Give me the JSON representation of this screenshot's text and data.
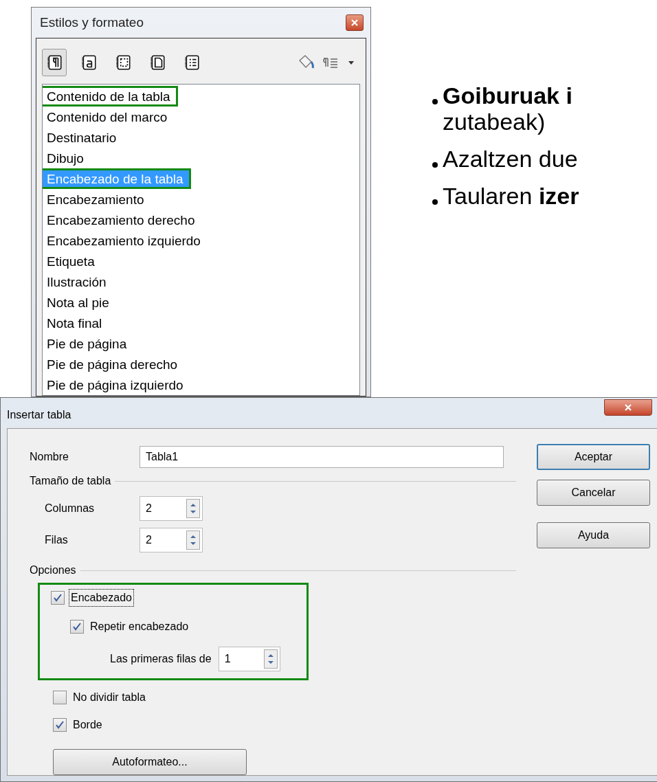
{
  "styles_panel": {
    "title": "Estilos y formateo",
    "toolbar": [
      {
        "kind": "paragraph",
        "selected": true
      },
      {
        "kind": "character",
        "selected": false
      },
      {
        "kind": "frame",
        "selected": false
      },
      {
        "kind": "page",
        "selected": false
      },
      {
        "kind": "list",
        "selected": false
      }
    ],
    "styles": [
      {
        "label": "Contenido de la tabla",
        "selected": false,
        "highlighted": true
      },
      {
        "label": "Contenido del marco",
        "selected": false,
        "highlighted": false
      },
      {
        "label": "Destinatario",
        "selected": false,
        "highlighted": false
      },
      {
        "label": "Dibujo",
        "selected": false,
        "highlighted": false
      },
      {
        "label": "Encabezado de la tabla",
        "selected": true,
        "highlighted": true
      },
      {
        "label": "Encabezamiento",
        "selected": false,
        "highlighted": false
      },
      {
        "label": "Encabezamiento derecho",
        "selected": false,
        "highlighted": false
      },
      {
        "label": "Encabezamiento izquierdo",
        "selected": false,
        "highlighted": false
      },
      {
        "label": "Etiqueta",
        "selected": false,
        "highlighted": false
      },
      {
        "label": "Ilustración",
        "selected": false,
        "highlighted": false
      },
      {
        "label": "Nota al pie",
        "selected": false,
        "highlighted": false
      },
      {
        "label": "Nota final",
        "selected": false,
        "highlighted": false
      },
      {
        "label": "Pie de página",
        "selected": false,
        "highlighted": false
      },
      {
        "label": "Pie de página derecho",
        "selected": false,
        "highlighted": false
      },
      {
        "label": "Pie de página izquierdo",
        "selected": false,
        "highlighted": false
      }
    ]
  },
  "slide_bullets": [
    {
      "lines": [
        "**Goiburuak i**",
        "zutabeak)"
      ]
    },
    {
      "lines": [
        "Azaltzen due"
      ]
    },
    {
      "lines": [
        "Taularen **izer**"
      ]
    }
  ],
  "dialog": {
    "title": "Insertar tabla",
    "name_label": "Nombre",
    "name_value": "Tabla1",
    "size_group": {
      "title": "Tamaño de tabla",
      "fields": [
        {
          "label": "Columnas",
          "value": "2"
        },
        {
          "label": "Filas",
          "value": "2"
        }
      ]
    },
    "options_group": {
      "title": "Opciones",
      "options": [
        {
          "kind": "checkbox",
          "label": "Encabezado",
          "checked": true,
          "focused": true,
          "highlighted": true,
          "children": [
            {
              "kind": "checkbox",
              "label": "Repetir encabezado",
              "checked": true,
              "focused": false,
              "children": [
                {
                  "kind": "spinner",
                  "label": "Las primeras filas de",
                  "value": "1"
                }
              ]
            }
          ]
        },
        {
          "kind": "checkbox",
          "label": "No dividir tabla",
          "checked": false,
          "focused": false,
          "highlighted": false
        },
        {
          "kind": "checkbox",
          "label": "Borde",
          "checked": true,
          "focused": false,
          "highlighted": false
        }
      ]
    },
    "autoformat_button": "Autoformateo...",
    "buttons": [
      {
        "label": "Aceptar",
        "default": true
      },
      {
        "label": "Cancelar",
        "default": false
      },
      {
        "label": "Ayuda",
        "default": false
      }
    ]
  }
}
